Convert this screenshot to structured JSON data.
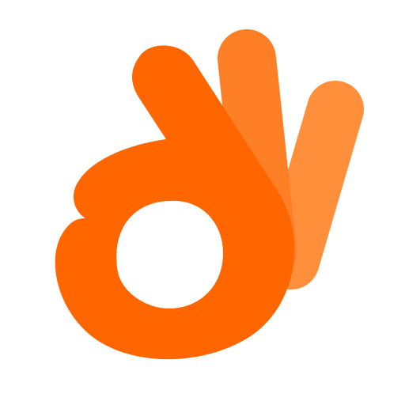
{
  "logo": {
    "icon": "ok-hand-gesture-icon",
    "colors": {
      "primary": "#FF6600",
      "middle_finger": "#FF7F27",
      "back_finger": "#FF8F3B",
      "background": "#FFFFFF"
    }
  }
}
